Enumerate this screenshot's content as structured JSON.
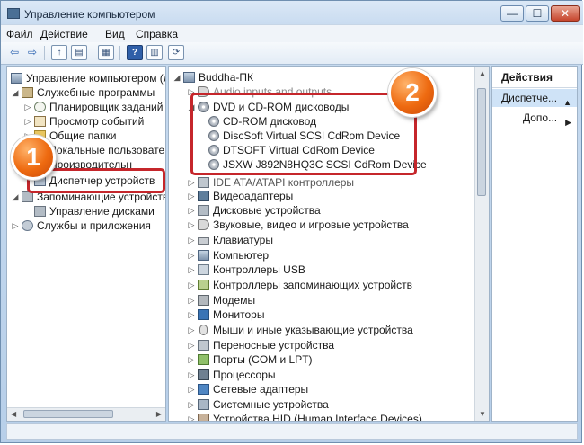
{
  "window": {
    "title": "Управление компьютером",
    "controls": {
      "minimize": "—",
      "maximize": "☐",
      "close": "✕"
    }
  },
  "menu": [
    "Файл",
    "Действие",
    "Вид",
    "Справка"
  ],
  "toolbar": {
    "back": "⇦",
    "forward": "⇨",
    "up": "↑",
    "show_hide": "▤",
    "properties": "▦",
    "help": "?",
    "pane": "▥",
    "scan": "⟳"
  },
  "left_tree": {
    "root": "Управление компьютером (л",
    "items": [
      {
        "label": "Служебные программы",
        "icon": "tools-icon"
      },
      {
        "label": "Планировщик заданий",
        "icon": "clock-icon"
      },
      {
        "label": "Просмотр событий",
        "icon": "event-log-icon"
      },
      {
        "label": "Общие папки",
        "icon": "folder-icon"
      },
      {
        "label": "Локальные пользовате",
        "icon": "users-icon"
      },
      {
        "label": "Производительн",
        "icon": "performance-icon"
      },
      {
        "label": "Диспетчер устройств",
        "icon": "device-manager-icon"
      },
      {
        "label": "Запоминающие устройства",
        "icon": "storage-icon"
      },
      {
        "label": "Управление дисками",
        "icon": "disk-icon"
      },
      {
        "label": "Службы и приложения",
        "icon": "services-icon"
      }
    ]
  },
  "device_tree": {
    "root": "Buddha-ПК",
    "partial_item": "Audio inputs and outputs",
    "dvd_group": "DVD и CD-ROM дисководы",
    "dvd_children": [
      "CD-ROM дисковод",
      "DiscSoft Virtual SCSI CdRom Device",
      "DTSOFT Virtual CdRom Device",
      "JSXW J892N8HQ3C SCSI CdRom Device"
    ],
    "categories": [
      {
        "label": "IDE ATA/ATAPI контроллеры",
        "icon": "ide-icon"
      },
      {
        "label": "Видеоадаптеры",
        "icon": "video-adapter-icon"
      },
      {
        "label": "Дисковые устройства",
        "icon": "disk-drive-icon"
      },
      {
        "label": "Звуковые, видео и игровые устройства",
        "icon": "sound-icon"
      },
      {
        "label": "Клавиатуры",
        "icon": "keyboard-icon"
      },
      {
        "label": "Компьютер",
        "icon": "computer-icon"
      },
      {
        "label": "Контроллеры USB",
        "icon": "usb-icon"
      },
      {
        "label": "Контроллеры запоминающих устройств",
        "icon": "storage-controller-icon"
      },
      {
        "label": "Модемы",
        "icon": "modem-icon"
      },
      {
        "label": "Мониторы",
        "icon": "monitor-icon"
      },
      {
        "label": "Мыши и иные указывающие устройства",
        "icon": "mouse-icon"
      },
      {
        "label": "Переносные устройства",
        "icon": "portable-device-icon"
      },
      {
        "label": "Порты (COM и LPT)",
        "icon": "port-icon"
      },
      {
        "label": "Процессоры",
        "icon": "cpu-icon"
      },
      {
        "label": "Сетевые адаптеры",
        "icon": "network-adapter-icon"
      },
      {
        "label": "Системные устройства",
        "icon": "system-device-icon"
      },
      {
        "label": "Устройства HID (Human Interface Devices)",
        "icon": "hid-icon"
      }
    ]
  },
  "actions": {
    "header": "Действия",
    "selected": "Диспетче...",
    "more": "Допо..."
  },
  "annotations": {
    "badge1": "1",
    "badge2": "2"
  },
  "colors": {
    "highlight": "#c5262b",
    "badge": "#ee6a10",
    "selection": "#cfe3f7"
  }
}
